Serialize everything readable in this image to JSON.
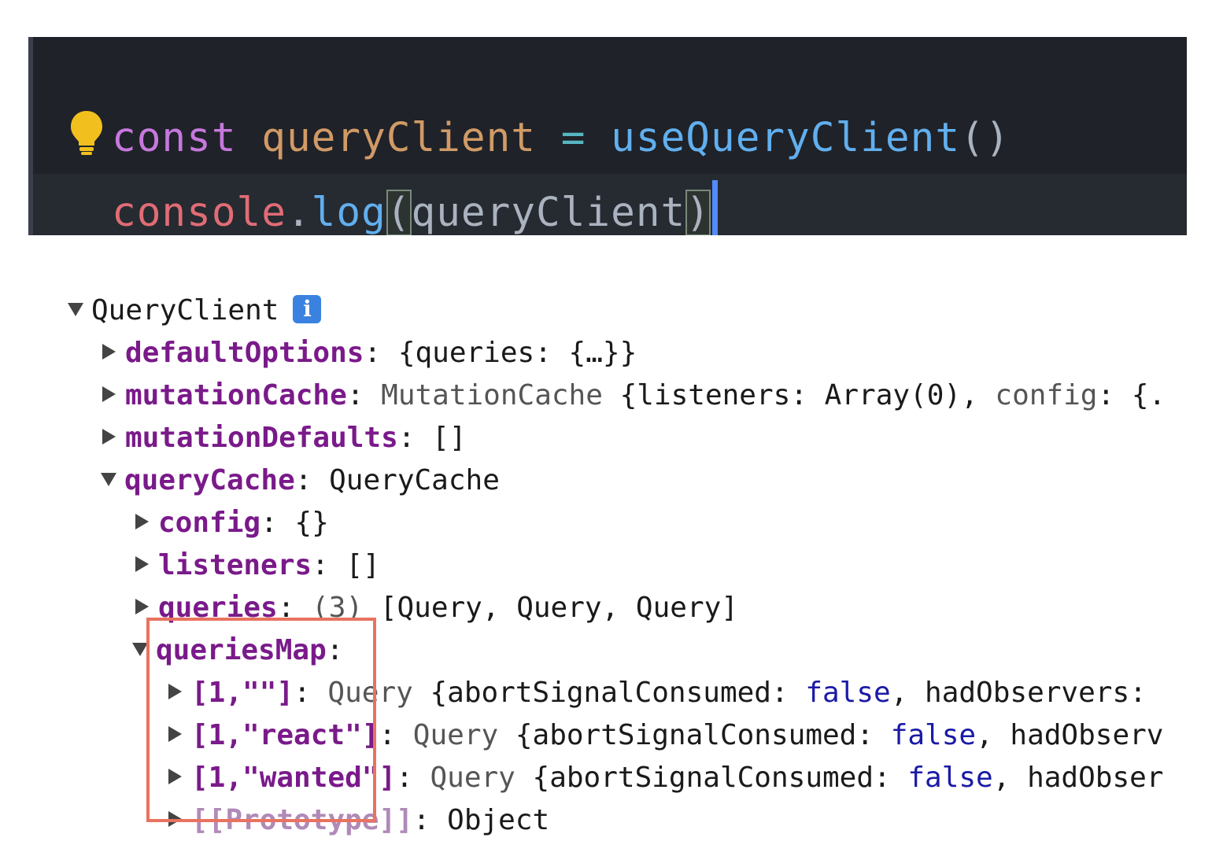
{
  "editor": {
    "line1": {
      "keyword": "const",
      "variable": "queryClient",
      "operator": "=",
      "function": "useQueryClient",
      "parens": "()"
    },
    "line2": {
      "object": "console",
      "dot": ".",
      "method": "log",
      "open_paren": "(",
      "argument": "queryClient",
      "close_paren": ")"
    }
  },
  "console": {
    "root": {
      "label": "QueryClient",
      "info": "i"
    },
    "rows": [
      {
        "key": "defaultOptions",
        "colon": ":",
        "value": "{queries: {…}}"
      },
      {
        "key": "mutationCache",
        "colon": ":",
        "type": "MutationCache",
        "value_a": "{listeners: Array(0), ",
        "value_b": "config",
        "value_c": ": {."
      },
      {
        "key": "mutationDefaults",
        "colon": ":",
        "value": "[]"
      },
      {
        "key": "queryCache",
        "colon": ":",
        "value": "QueryCache"
      }
    ],
    "queryCache_children": [
      {
        "key": "config",
        "colon": ":",
        "value": "{}"
      },
      {
        "key": "listeners",
        "colon": ":",
        "value": "[]"
      },
      {
        "key": "queries",
        "colon": ":",
        "count": "(3)",
        "value": "[Query, Query, Query]"
      },
      {
        "key": "queriesMap",
        "colon": ":"
      }
    ],
    "queriesMap_children": [
      {
        "key": "[1,\"\"]",
        "colon": ":",
        "type": "Query",
        "value_a": "{abortSignalConsumed: ",
        "bool": "false",
        "value_b": ", hadObservers:"
      },
      {
        "key": "[1,\"react\"]",
        "colon": ":",
        "type": "Query",
        "value_a": "{abortSignalConsumed: ",
        "bool": "false",
        "value_b": ", hadObserv"
      },
      {
        "key": "[1,\"wanted\"]",
        "colon": ":",
        "type": "Query",
        "value_a": "{abortSignalConsumed: ",
        "bool": "false",
        "value_b": ", hadObser"
      },
      {
        "key": "[[Prototype]]",
        "colon": ":",
        "value": "Object"
      }
    ]
  },
  "colors": {
    "editor_bg": "#1f2228",
    "keyword": "#c678dd",
    "variable": "#d19a66",
    "function": "#61afef",
    "object": "#e06c75",
    "console_key": "#7a1a8a",
    "boolean": "#1a1aa6",
    "highlight_border": "#e8735f",
    "info_badge": "#3b82e0"
  },
  "icons": {
    "lightbulb": "lightbulb-icon",
    "info": "info-icon",
    "expand": "triangle-right-icon",
    "collapse": "triangle-down-icon"
  }
}
